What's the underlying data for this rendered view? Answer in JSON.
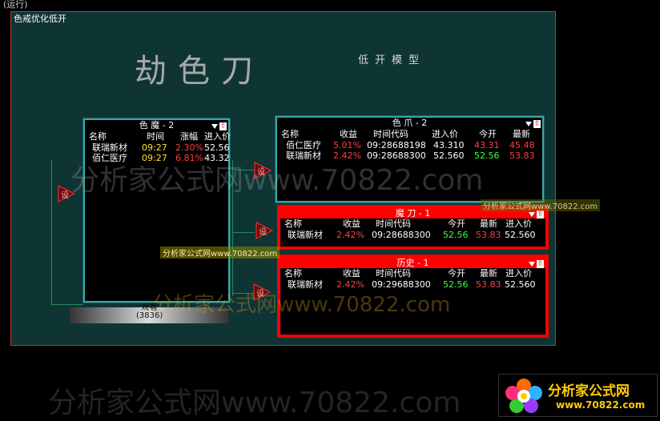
{
  "top_label": "(运行)",
  "frame_title": "色戒优化低开",
  "big_title": "劫色刀",
  "sub_title": "低开模型",
  "she_label": "设",
  "panels": {
    "semo": {
      "title": "色  魔 - 2",
      "columns": [
        "名称",
        "时间",
        "涨幅",
        "进入价"
      ],
      "rows": [
        {
          "name": "联瑞新材",
          "time": "09:27",
          "change": "2.30%",
          "price": "52.56"
        },
        {
          "name": "佰仁医疗",
          "time": "09:27",
          "change": "6.81%",
          "price": "43.32"
        }
      ]
    },
    "sezhua": {
      "title": "色  爪 - 2",
      "columns": [
        "名称",
        "收益",
        "时间代码",
        "进入价",
        "今开",
        "最新"
      ],
      "rows": [
        {
          "name": "佰仁医疗",
          "profit": "5.01%",
          "code": "09:28688198",
          "price": "43.310",
          "open": "43.31",
          "latest": "45.48"
        },
        {
          "name": "联瑞新材",
          "profit": "2.42%",
          "code": "09:28688300",
          "price": "52.560",
          "open": "52.56",
          "latest": "53.83"
        }
      ]
    },
    "modao": {
      "title": "魔  刀 - 1",
      "columns": [
        "名称",
        "收益",
        "时间代码",
        "今开",
        "最新",
        "进入价"
      ],
      "rows": [
        {
          "name": "联瑞新材",
          "profit": "2.42%",
          "code": "09:28688300",
          "open": "52.56",
          "latest": "53.83",
          "price": "52.560"
        }
      ]
    },
    "lishi": {
      "title": "历史 - 1",
      "columns": [
        "名称",
        "收益",
        "时间代码",
        "今开",
        "最新",
        "进入价"
      ],
      "rows": [
        {
          "name": "联瑞新材",
          "profit": "2.42%",
          "code": "09:29688300",
          "open": "52.56",
          "latest": "53.83",
          "price": "52.560"
        }
      ]
    }
  },
  "disk_label_1": "观看",
  "disk_label_2": "(3836)",
  "watermark_big": "分析家公式网www.70822.com",
  "watermark_tag": "分析家公式网www.70822.com",
  "watermark_bottom": "分析家公式网www.70822.com",
  "logo_text": "分析家公式网",
  "logo_url": "www.70822.com",
  "colors": {
    "frame_bg": "#0f3434",
    "panel_border": "#3aa8a8",
    "active_red": "#ff0000",
    "yellow": "#ffe030",
    "red_text": "#ff4040",
    "green_text": "#40ff40"
  }
}
